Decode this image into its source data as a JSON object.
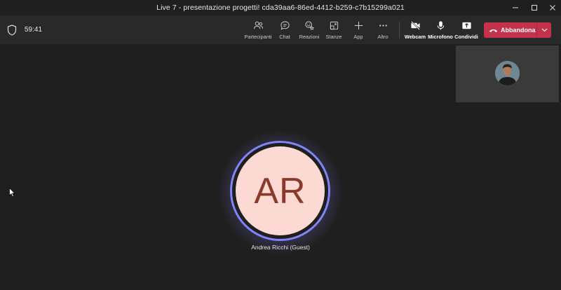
{
  "window": {
    "title": "Live 7 - presentazione progetti! cda39aa6-86ed-4412-b259-c7b15299a021"
  },
  "toolbar": {
    "timer": "59:41",
    "buttons": {
      "participants": "Partecipanti",
      "chat": "Chat",
      "reactions": "Reazioni",
      "rooms": "Stanze",
      "apps": "App",
      "more": "Altro",
      "webcam": "Webcam",
      "microphone": "Microfono",
      "share": "Condividi"
    },
    "leave_label": "Abbandona"
  },
  "stage": {
    "participant_initials": "AR",
    "participant_name": "Andrea Ricchi (Guest)"
  },
  "colors": {
    "leave": "#c4314b",
    "ring": "#7f85f5",
    "avatar_bg": "#fcd9d3",
    "avatar_text": "#8a3a2c"
  }
}
